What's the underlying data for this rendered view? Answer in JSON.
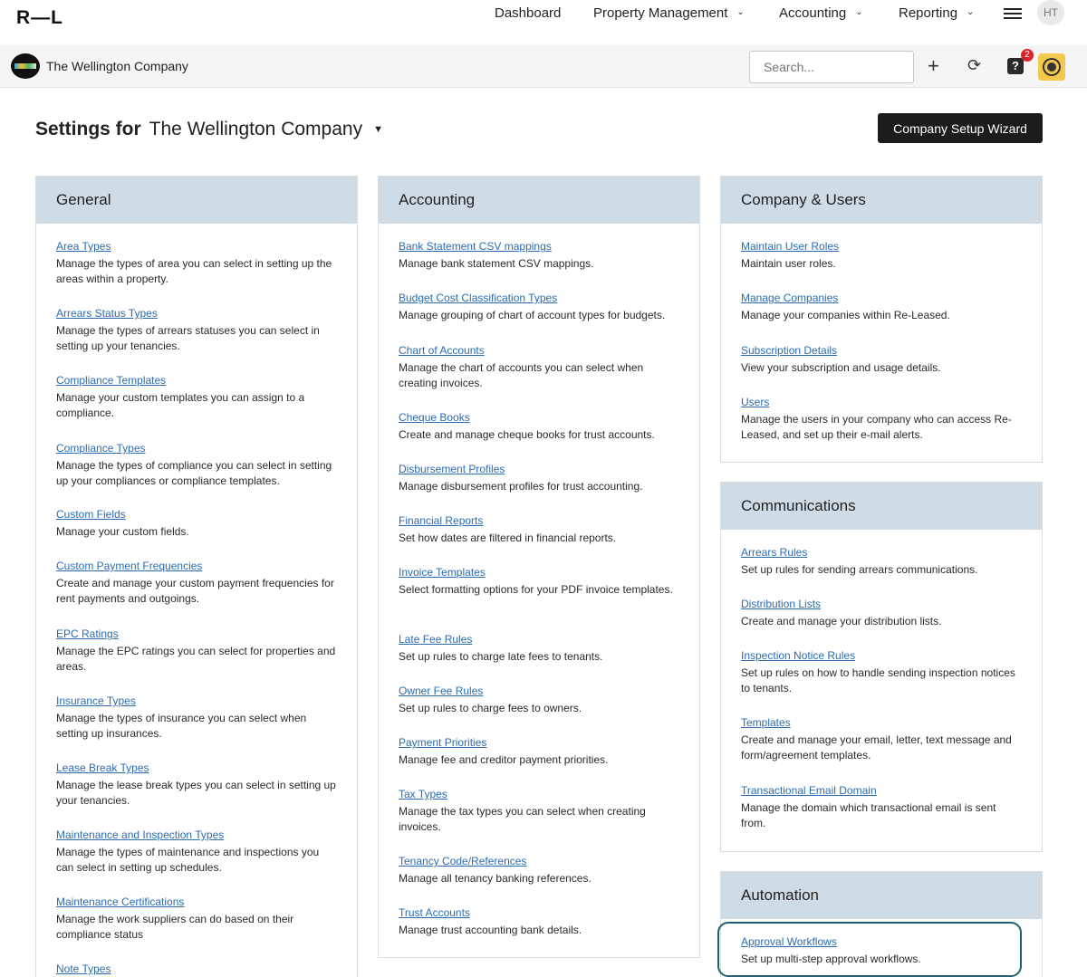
{
  "topnav": {
    "logo": "R—L",
    "items": [
      {
        "label": "Dashboard"
      },
      {
        "label": "Property Management"
      },
      {
        "label": "Accounting"
      },
      {
        "label": "Reporting"
      }
    ],
    "avatar_initials": "HT"
  },
  "companybar": {
    "company_name": "The Wellington Company",
    "search_placeholder": "Search...",
    "help_badge_count": "2"
  },
  "page": {
    "title_prefix": "Settings for",
    "company_selected": "The Wellington Company",
    "wizard_button": "Company Setup Wizard"
  },
  "panels": {
    "general": {
      "title": "General",
      "items": [
        {
          "link": "Area Types",
          "desc": "Manage the types of area you can select in setting up the areas within a property."
        },
        {
          "link": "Arrears Status Types",
          "desc": "Manage the types of arrears statuses you can select in setting up your tenancies."
        },
        {
          "link": "Compliance Templates",
          "desc": "Manage your custom templates you can assign to a compliance."
        },
        {
          "link": "Compliance Types",
          "desc": "Manage the types of compliance you can select in setting up your compliances or compliance templates."
        },
        {
          "link": "Custom Fields",
          "desc": "Manage your custom fields."
        },
        {
          "link": "Custom Payment Frequencies",
          "desc": "Create and manage your custom payment frequencies for rent payments and outgoings."
        },
        {
          "link": "EPC Ratings",
          "desc": "Manage the EPC ratings you can select for properties and areas."
        },
        {
          "link": "Insurance Types",
          "desc": "Manage the types of insurance you can select when setting up insurances."
        },
        {
          "link": "Lease Break Types",
          "desc": "Manage the lease break types you can select in setting up your tenancies."
        },
        {
          "link": "Maintenance and Inspection Types",
          "desc": "Manage the types of maintenance and inspections you can select in setting up schedules."
        },
        {
          "link": "Maintenance Certifications",
          "desc": "Manage the work suppliers can do based on their compliance status"
        },
        {
          "link": "Note Types",
          "desc": ""
        }
      ]
    },
    "accounting": {
      "title": "Accounting",
      "items": [
        {
          "link": "Bank Statement CSV mappings",
          "desc": "Manage bank statement CSV mappings."
        },
        {
          "link": "Budget Cost Classification Types",
          "desc": "Manage grouping of chart of account types for budgets."
        },
        {
          "link": "Chart of Accounts",
          "desc": "Manage the chart of accounts you can select when creating invoices."
        },
        {
          "link": "Cheque Books",
          "desc": "Create and manage cheque books for trust accounts."
        },
        {
          "link": "Disbursement Profiles",
          "desc": "Manage disbursement profiles for trust accounting."
        },
        {
          "link": "Financial Reports",
          "desc": "Set how dates are filtered in financial reports."
        },
        {
          "link": "Invoice Templates",
          "desc": "Select formatting options for your PDF invoice templates."
        },
        {
          "link": "Late Fee Rules",
          "desc": "Set up rules to charge late fees to tenants."
        },
        {
          "link": "Owner Fee Rules",
          "desc": "Set up rules to charge fees to owners."
        },
        {
          "link": "Payment Priorities",
          "desc": "Manage fee and creditor payment priorities."
        },
        {
          "link": "Tax Types",
          "desc": "Manage the tax types you can select when creating invoices."
        },
        {
          "link": "Tenancy Code/References",
          "desc": "Manage all tenancy banking references."
        },
        {
          "link": "Trust Accounts",
          "desc": "Manage trust accounting bank details."
        }
      ]
    },
    "company_users": {
      "title": "Company & Users",
      "items": [
        {
          "link": "Maintain User Roles",
          "desc": "Maintain user roles."
        },
        {
          "link": "Manage Companies",
          "desc": "Manage your companies within Re-Leased."
        },
        {
          "link": "Subscription Details",
          "desc": "View your subscription and usage details."
        },
        {
          "link": "Users",
          "desc": "Manage the users in your company who can access Re-Leased, and set up their e-mail alerts."
        }
      ]
    },
    "communications": {
      "title": "Communications",
      "items": [
        {
          "link": "Arrears Rules",
          "desc": "Set up rules for sending arrears communications."
        },
        {
          "link": "Distribution Lists",
          "desc": "Create and manage your distribution lists."
        },
        {
          "link": "Inspection Notice Rules",
          "desc": "Set up rules on how to handle sending inspection notices to tenants."
        },
        {
          "link": "Templates",
          "desc": "Create and manage your email, letter, text message and form/agreement templates."
        },
        {
          "link": "Transactional Email Domain",
          "desc": "Manage the domain which transactional email is sent from."
        }
      ]
    },
    "automation": {
      "title": "Automation",
      "items": [
        {
          "link": "Approval Workflows",
          "desc": "Set up multi-step approval workflows."
        }
      ]
    }
  }
}
